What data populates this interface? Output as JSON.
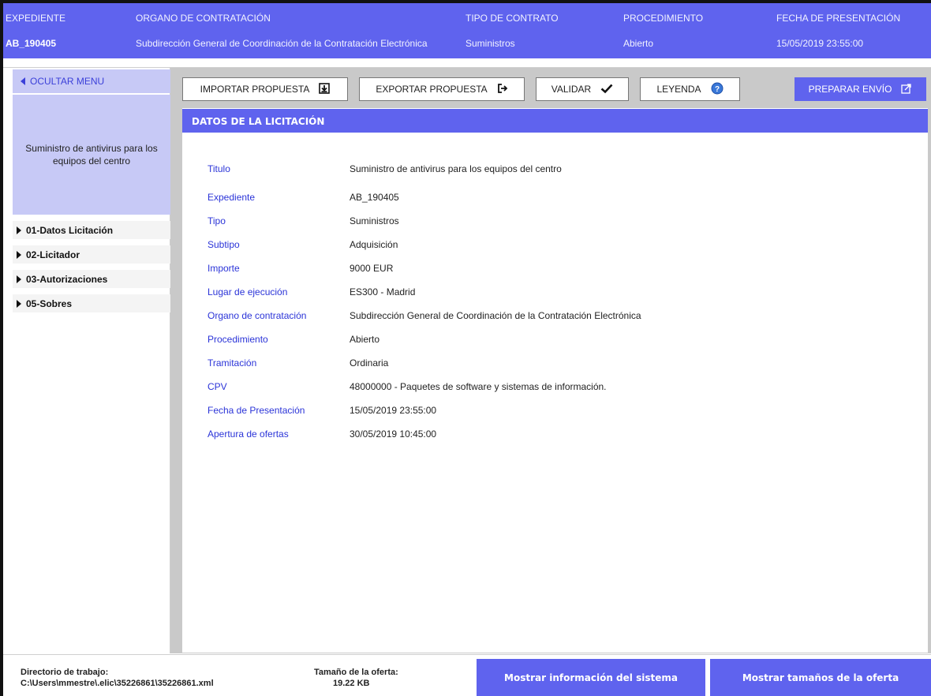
{
  "header": {
    "expediente_label": "EXPEDIENTE",
    "expediente_value": "AB_190405",
    "organo_label": "ORGANO DE CONTRATACIÓN",
    "organo_value": "Subdirección General de Coordinación de la Contratación Electrónica",
    "tipo_label": "TIPO DE CONTRATO",
    "tipo_value": "Suministros",
    "procedimiento_label": "PROCEDIMIENTO",
    "procedimiento_value": "Abierto",
    "fecha_label": "FECHA DE PRESENTACIÓN",
    "fecha_value": "15/05/2019 23:55:00"
  },
  "sidebar": {
    "toggle_label": "OCULTAR MENU",
    "title": "Suministro de antivirus para los equipos del centro",
    "items": [
      {
        "label": "01-Datos Licitación"
      },
      {
        "label": "02-Licitador"
      },
      {
        "label": "03-Autorizaciones"
      },
      {
        "label": "05-Sobres"
      }
    ]
  },
  "toolbar": {
    "importar": "IMPORTAR PROPUESTA",
    "exportar": "EXPORTAR PROPUESTA",
    "validar": "VALIDAR",
    "leyenda": "LEYENDA",
    "preparar": "PREPARAR ENVÍO",
    "icons": {
      "importar": "download-icon",
      "exportar": "export-icon",
      "validar": "check-icon",
      "leyenda": "help-icon",
      "preparar": "send-icon"
    }
  },
  "section": {
    "title": "DATOS DE LA LICITACIÓN"
  },
  "fields": [
    {
      "label": "Titulo",
      "value": "Suministro de antivirus para los equipos del centro"
    },
    {
      "label": "Expediente",
      "value": "AB_190405"
    },
    {
      "label": "Tipo",
      "value": "Suministros"
    },
    {
      "label": "Subtipo",
      "value": "Adquisición"
    },
    {
      "label": "Importe",
      "value": "9000 EUR"
    },
    {
      "label": "Lugar de ejecución",
      "value": "ES300 - Madrid"
    },
    {
      "label": "Organo de contratación",
      "value": "Subdirección General de Coordinación de la Contratación Electrónica"
    },
    {
      "label": "Procedimiento",
      "value": "Abierto"
    },
    {
      "label": "Tramitación",
      "value": "Ordinaria"
    },
    {
      "label": "CPV",
      "value": "48000000 - Paquetes de software y sistemas de información."
    },
    {
      "label": "Fecha de Presentación",
      "value": "15/05/2019 23:55:00"
    },
    {
      "label": "Apertura de ofertas",
      "value": "30/05/2019 10:45:00"
    }
  ],
  "footer": {
    "dir_label": "Directorio de trabajo:",
    "dir_value": "C:\\Users\\mmestre\\.elic\\35226861\\35226861.xml",
    "size_label": "Tamaño de la oferta:",
    "size_value": "19.22 KB",
    "btn_sistema": "Mostrar información del sistema",
    "btn_tamanos": "Mostrar tamaños de la oferta"
  },
  "colors": {
    "accent": "#5f63ee",
    "sidebar_light": "#c7c9f6",
    "label_blue": "#2b34d8",
    "main_bg": "#c9c9c9"
  }
}
